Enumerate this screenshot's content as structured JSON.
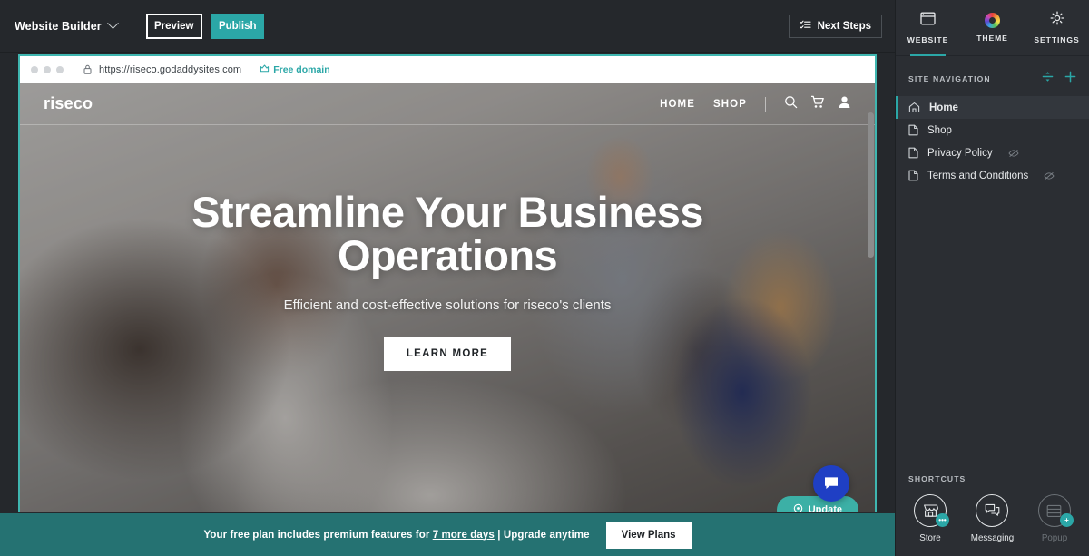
{
  "toolbar": {
    "brand_label": "Website Builder",
    "brand_chevron": "chevron-down-icon",
    "preview_label": "Preview",
    "publish_label": "Publish",
    "next_steps_label": "Next Steps",
    "next_steps_icon": "checklist-icon",
    "accent_teal": "#2ba7a7"
  },
  "browser": {
    "lock_icon": "lock-icon",
    "url": "https://riseco.godaddysites.com",
    "free_domain_label": "Free domain",
    "free_domain_icon": "crown-icon"
  },
  "site": {
    "logo": "riseco",
    "nav": [
      {
        "label": "HOME"
      },
      {
        "label": "SHOP"
      }
    ],
    "icons": [
      {
        "name": "search-icon"
      },
      {
        "name": "cart-icon"
      },
      {
        "name": "account-icon"
      }
    ],
    "hero": {
      "heading": "Streamline Your Business Operations",
      "subheading": "Efficient and cost-effective solutions for riseco's clients",
      "cta_label": "LEARN MORE"
    },
    "chat_icon": "chat-bubble-icon",
    "update_label": "Update",
    "update_icon": "refresh-icon"
  },
  "promo": {
    "text_before": "Your free plan includes premium features for ",
    "days_link": "7 more days",
    "text_after": " | Upgrade anytime",
    "button_label": "View Plans",
    "background": "#257272"
  },
  "sidebar": {
    "tabs": [
      {
        "label": "WEBSITE",
        "icon": "website-icon",
        "active": true
      },
      {
        "label": "THEME",
        "icon": "theme-color-wheel-icon",
        "active": false
      },
      {
        "label": "SETTINGS",
        "icon": "gear-icon",
        "active": false
      }
    ],
    "navigation": {
      "title": "SITE NAVIGATION",
      "reorder_icon": "reorder-icon",
      "add_icon": "plus-icon",
      "items": [
        {
          "label": "Home",
          "icon": "home-icon",
          "active": true,
          "hidden": false
        },
        {
          "label": "Shop",
          "icon": "page-icon",
          "active": false,
          "hidden": false
        },
        {
          "label": "Privacy Policy",
          "icon": "page-icon",
          "active": false,
          "hidden": true
        },
        {
          "label": "Terms and Conditions",
          "icon": "page-icon",
          "active": false,
          "hidden": true
        }
      ]
    },
    "shortcuts": {
      "title": "SHORTCUTS",
      "items": [
        {
          "label": "Store",
          "icon": "store-icon",
          "badge": "•••",
          "dim": false
        },
        {
          "label": "Messaging",
          "icon": "messaging-icon",
          "badge": "",
          "dim": false
        },
        {
          "label": "Popup",
          "icon": "popup-icon",
          "badge": "+",
          "dim": true
        }
      ]
    }
  }
}
